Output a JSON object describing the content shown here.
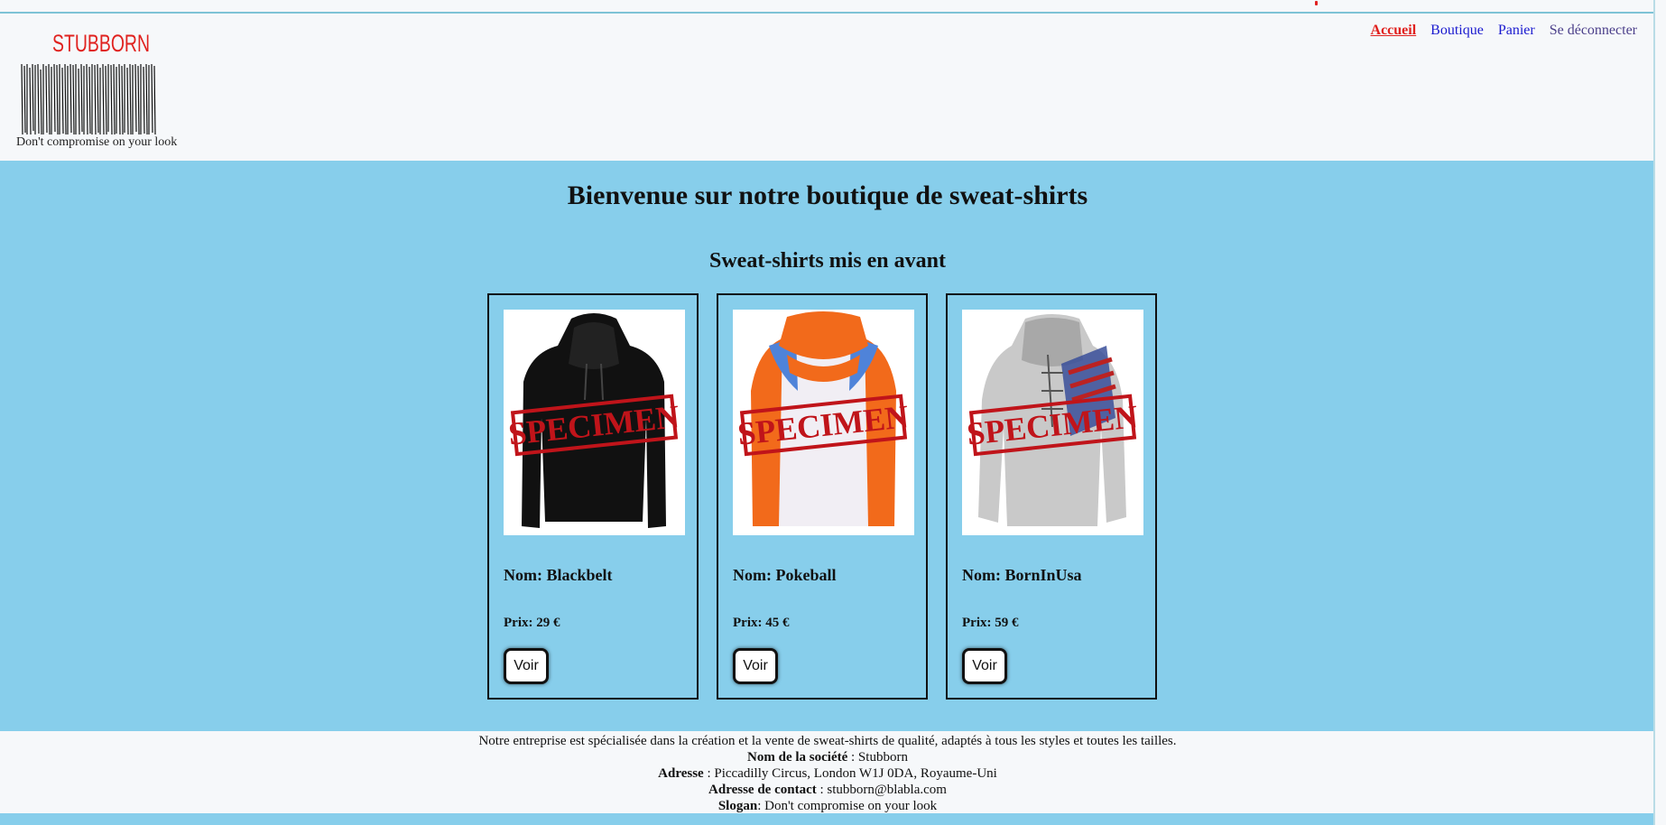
{
  "brand": {
    "logo_text": "STUBBORN",
    "slogan": "Don't compromise on your look"
  },
  "nav": {
    "items": [
      {
        "label": "Accueil"
      },
      {
        "label": "Boutique"
      },
      {
        "label": "Panier"
      },
      {
        "label": "Se déconnecter"
      }
    ]
  },
  "main": {
    "title": "Bienvenue sur notre boutique de sweat-shirts",
    "featured_title": "Sweat-shirts mis en avant",
    "products": [
      {
        "name": "Nom: Blackbelt",
        "price": "Prix: 29 €",
        "button": "Voir",
        "stamp": "SPECIMEN",
        "image_icon": "black-hoodie"
      },
      {
        "name": "Nom: Pokeball",
        "price": "Prix: 45 €",
        "button": "Voir",
        "stamp": "SPECIMEN",
        "image_icon": "orange-white-hoodie"
      },
      {
        "name": "Nom: BornInUsa",
        "price": "Prix: 59 €",
        "button": "Voir",
        "stamp": "SPECIMEN",
        "image_icon": "grey-flag-hoodie"
      }
    ]
  },
  "footer": {
    "description": "Notre entreprise est spécialisée dans la création et la vente de sweat-shirts de qualité, adaptés à tous les styles et toutes les tailles.",
    "company_label": "Nom de la société",
    "company_value": " : Stubborn",
    "address_label": "Adresse",
    "address_value": " : Piccadilly Circus, London W1J 0DA, Royaume-Uni",
    "contact_label": "Adresse de contact",
    "contact_value": " : stubborn@blabla.com",
    "slogan_label": "Slogan",
    "slogan_value": ": Don't compromise on your look"
  },
  "colors": {
    "background": "#87ceeb",
    "header_bg": "#f6f8fa",
    "accent_red": "#e0221f",
    "link_blue": "#1a1acf"
  }
}
